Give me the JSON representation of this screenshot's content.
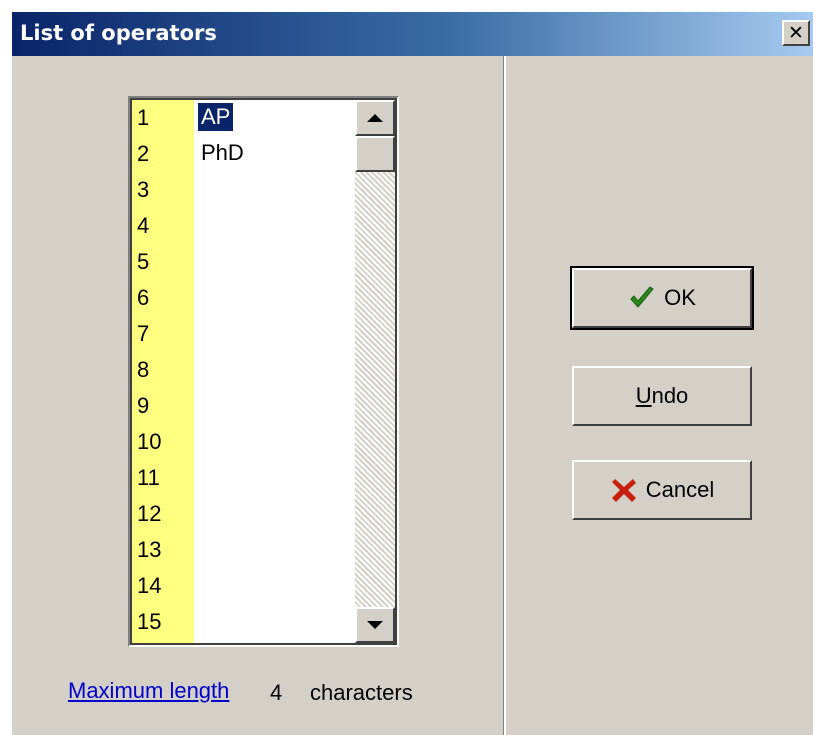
{
  "window": {
    "title": "List of operators",
    "close_glyph": "✕"
  },
  "list": {
    "rows": [
      {
        "num": "1",
        "value": "AP",
        "selected": true
      },
      {
        "num": "2",
        "value": "PhD",
        "selected": false
      },
      {
        "num": "3",
        "value": "",
        "selected": false
      },
      {
        "num": "4",
        "value": "",
        "selected": false
      },
      {
        "num": "5",
        "value": "",
        "selected": false
      },
      {
        "num": "6",
        "value": "",
        "selected": false
      },
      {
        "num": "7",
        "value": "",
        "selected": false
      },
      {
        "num": "8",
        "value": "",
        "selected": false
      },
      {
        "num": "9",
        "value": "",
        "selected": false
      },
      {
        "num": "10",
        "value": "",
        "selected": false
      },
      {
        "num": "11",
        "value": "",
        "selected": false
      },
      {
        "num": "12",
        "value": "",
        "selected": false
      },
      {
        "num": "13",
        "value": "",
        "selected": false
      },
      {
        "num": "14",
        "value": "",
        "selected": false
      },
      {
        "num": "15",
        "value": "",
        "selected": false
      }
    ]
  },
  "footer": {
    "max_length_label": "Maximum length",
    "max_length_value": "4",
    "max_length_unit": "characters"
  },
  "buttons": {
    "ok_label": "OK",
    "undo_mnemonic": "U",
    "undo_rest": "ndo",
    "cancel_label": "Cancel"
  },
  "icons": {
    "ok": "check-icon",
    "cancel": "x-icon"
  },
  "colors": {
    "number_column": "#ffff80",
    "selection": "#0a246a",
    "check": "#2a8a1a",
    "cross": "#c81e10",
    "link": "#0000cc"
  }
}
